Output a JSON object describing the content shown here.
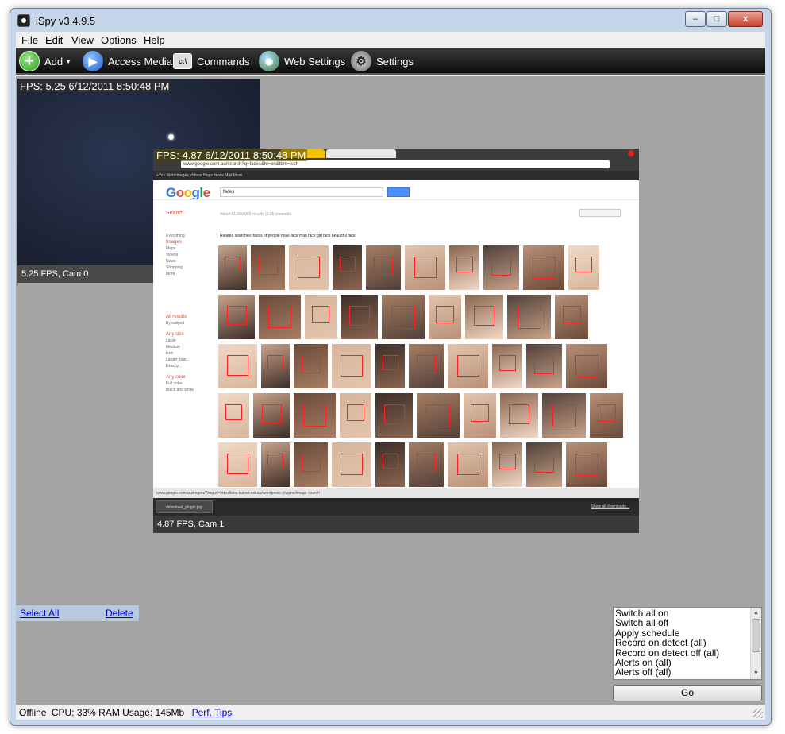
{
  "window": {
    "title": "iSpy v3.4.9.5",
    "buttons": {
      "minimize": "–",
      "maximize": "□",
      "close": "x"
    }
  },
  "menu": [
    "File",
    "Edit",
    "View",
    "Options",
    "Help"
  ],
  "toolbar": {
    "add": "Add",
    "access_media": "Access Media",
    "commands": "Commands",
    "web_settings": "Web Settings",
    "settings": "Settings"
  },
  "cameras": [
    {
      "overlay": "FPS: 5.25 6/12/2011 8:50:48 PM",
      "footer": "5.25 FPS, Cam 0"
    },
    {
      "overlay": "FPS: 4.87 6/12/2011 8:50:48 PM",
      "footer": "4.87 FPS, Cam 1"
    }
  ],
  "browser": {
    "address": "www.google.com.au/search?q=faces&hl=en&tbm=isch",
    "search_query": "faces",
    "results_text": "About 61,000,000 results (0.05 seconds)",
    "related": "Related searches: faces of people  male face  man face  girl face  beautiful face",
    "left_search_label": "Search",
    "left_nav": [
      "Everything",
      "Images",
      "Maps",
      "Videos",
      "News",
      "Shopping",
      "More"
    ],
    "left_filters": [
      "All results",
      "By subject",
      "Any size",
      "Large",
      "Medium",
      "Icon",
      "Larger than...",
      "Exactly...",
      "Any color",
      "Full color",
      "Black and white"
    ],
    "status": "www.google.com.au/imgres?imgurl=http://blog.lasnet.net.au/wordpress-plugins/image-search",
    "download_file": "download_plugin.jpg",
    "download_show_all": "Show all downloads..."
  },
  "actions": {
    "select_all": "Select All",
    "delete": "Delete"
  },
  "command_list": [
    "Switch all on",
    "Switch all off",
    "Apply schedule",
    "Record on detect (all)",
    "Record on detect off (all)",
    "Alerts on (all)",
    "Alerts off (all)"
  ],
  "go_button": "Go",
  "status": {
    "state": "Offline",
    "usage": "CPU: 33% RAM Usage: 145Mb",
    "perf_link": "Perf. Tips"
  },
  "colors": {
    "toolbar": "#0c0c0c",
    "desktop": "#a3a3a3",
    "link": "#0000cc"
  }
}
